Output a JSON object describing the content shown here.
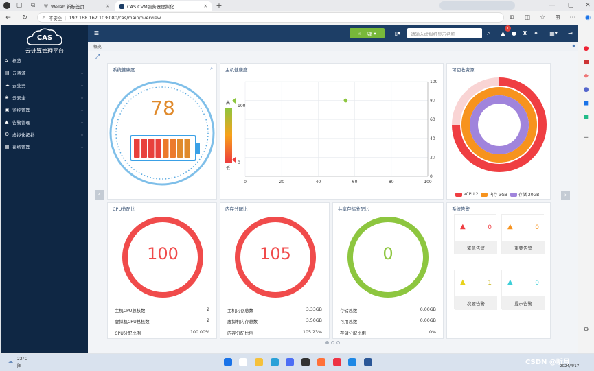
{
  "browser": {
    "tab1": "WeTab 新标签页",
    "tab2": "CAS CVM服务器虚拟化",
    "insecure": "不安全",
    "url": "192.168.162.10:8080/cas/main/overview"
  },
  "sidebar": {
    "logo": "CAS",
    "logo_title": "云计算管理平台",
    "items": [
      {
        "label": "概览",
        "icon": "home-icon"
      },
      {
        "label": "云资源",
        "icon": "server-icon"
      },
      {
        "label": "云业务",
        "icon": "cloud-icon"
      },
      {
        "label": "云安全",
        "icon": "shield-icon"
      },
      {
        "label": "监控管理",
        "icon": "monitor-icon"
      },
      {
        "label": "告警管理",
        "icon": "bell-icon"
      },
      {
        "label": "虚拟化拓扑",
        "icon": "topology-icon"
      },
      {
        "label": "系统管理",
        "icon": "settings-icon"
      }
    ]
  },
  "topbar": {
    "one_key": "一键",
    "search_placeholder": "请输入虚拟机显示名称",
    "alarm_count": "1"
  },
  "breadcrumb": "概览",
  "health": {
    "title": "系统健康度",
    "score": "78",
    "battery_bars": 8
  },
  "host_health": {
    "title": "主机健康度",
    "legend_high": "高",
    "legend_low": "低",
    "legend_max": "100",
    "legend_min": "0",
    "chart_data": {
      "type": "scatter",
      "x": [
        55
      ],
      "y": [
        80
      ],
      "xlim": [
        0,
        100
      ],
      "ylim": [
        0,
        100
      ],
      "xticks": [
        "0",
        "20",
        "40",
        "60",
        "80",
        "100"
      ],
      "yticks": [
        "0",
        "20",
        "40",
        "60",
        "80",
        "100"
      ],
      "colors": {
        "point": "#8dc63f"
      },
      "legend_colors": [
        "#8dc63f",
        "#f7a21b",
        "#ee3d3d"
      ]
    }
  },
  "recyclable": {
    "title": "可回收资源",
    "chart_data": {
      "type": "pie",
      "series": [
        {
          "name": "vCPU 2",
          "value": 2,
          "color": "#ef3e42",
          "frac": 0.75
        },
        {
          "name": "内存 3GB",
          "value": 3,
          "color": "#f7931e",
          "frac": 1.0
        },
        {
          "name": "存储 20GB",
          "value": 20,
          "color": "#a084dc",
          "frac": 1.0
        }
      ]
    }
  },
  "cpu": {
    "title": "CPU分配比",
    "value": "100",
    "color": "#f04b4b",
    "rows": [
      {
        "k": "主机CPU总核数",
        "v": "2"
      },
      {
        "k": "虚拟机CPU总核数",
        "v": "2"
      },
      {
        "k": "CPU分配比例",
        "v": "100.00%"
      }
    ]
  },
  "mem": {
    "title": "内存分配比",
    "value": "105",
    "color": "#f04b4b",
    "rows": [
      {
        "k": "主机内存总数",
        "v": "3.33GB"
      },
      {
        "k": "虚拟机内存总数",
        "v": "3.50GB"
      },
      {
        "k": "内存分配比例",
        "v": "105.23%"
      }
    ]
  },
  "storage": {
    "title": "共享存储分配比",
    "value": "0",
    "color": "#8dc63f",
    "rows": [
      {
        "k": "存储总数",
        "v": "0.00GB"
      },
      {
        "k": "可用总数",
        "v": "0.00GB"
      },
      {
        "k": "存储分配比例",
        "v": "0%"
      }
    ]
  },
  "alarms": {
    "title": "系统告警",
    "items": [
      {
        "label": "紧急告警",
        "count": "0",
        "color": "#ef3e42"
      },
      {
        "label": "重要告警",
        "count": "0",
        "color": "#f7931e"
      },
      {
        "label": "次要告警",
        "count": "1",
        "color": "#e8d21b"
      },
      {
        "label": "提示告警",
        "count": "0",
        "color": "#3ecfd8"
      }
    ]
  },
  "taskbar": {
    "weather_temp": "22°C",
    "weather_desc": "阴",
    "watermark": "CSDN @昕月",
    "date": "2024/4/17"
  }
}
